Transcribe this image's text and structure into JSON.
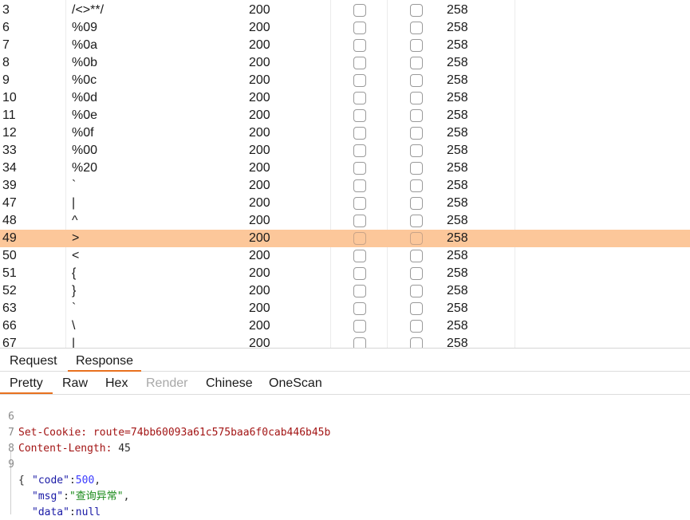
{
  "table": {
    "rows": [
      {
        "num": "3",
        "payload": "/<>**/",
        "status": "200",
        "length": "258",
        "selected": false
      },
      {
        "num": "6",
        "payload": "%09",
        "status": "200",
        "length": "258",
        "selected": false
      },
      {
        "num": "7",
        "payload": "%0a",
        "status": "200",
        "length": "258",
        "selected": false
      },
      {
        "num": "8",
        "payload": "%0b",
        "status": "200",
        "length": "258",
        "selected": false
      },
      {
        "num": "9",
        "payload": "%0c",
        "status": "200",
        "length": "258",
        "selected": false
      },
      {
        "num": "10",
        "payload": "%0d",
        "status": "200",
        "length": "258",
        "selected": false
      },
      {
        "num": "11",
        "payload": "%0e",
        "status": "200",
        "length": "258",
        "selected": false
      },
      {
        "num": "12",
        "payload": "%0f",
        "status": "200",
        "length": "258",
        "selected": false
      },
      {
        "num": "33",
        "payload": "%00",
        "status": "200",
        "length": "258",
        "selected": false
      },
      {
        "num": "34",
        "payload": "%20",
        "status": "200",
        "length": "258",
        "selected": false
      },
      {
        "num": "39",
        "payload": "`",
        "status": "200",
        "length": "258",
        "selected": false
      },
      {
        "num": "47",
        "payload": "|",
        "status": "200",
        "length": "258",
        "selected": false
      },
      {
        "num": "48",
        "payload": "^",
        "status": "200",
        "length": "258",
        "selected": false
      },
      {
        "num": "49",
        "payload": ">",
        "status": "200",
        "length": "258",
        "selected": true
      },
      {
        "num": "50",
        "payload": "<",
        "status": "200",
        "length": "258",
        "selected": false
      },
      {
        "num": "51",
        "payload": "{",
        "status": "200",
        "length": "258",
        "selected": false
      },
      {
        "num": "52",
        "payload": "}",
        "status": "200",
        "length": "258",
        "selected": false
      },
      {
        "num": "63",
        "payload": "`",
        "status": "200",
        "length": "258",
        "selected": false
      },
      {
        "num": "66",
        "payload": "\\",
        "status": "200",
        "length": "258",
        "selected": false
      },
      {
        "num": "67",
        "payload": "|",
        "status": "200",
        "length": "258",
        "selected": false
      }
    ],
    "selected_color": "#fcc79a"
  },
  "message_tabs": {
    "request": "Request",
    "response": "Response",
    "active": "response"
  },
  "view_tabs": {
    "pretty": "Pretty",
    "raw": "Raw",
    "hex": "Hex",
    "render": "Render",
    "chinese": "Chinese",
    "onescan": "OneScan",
    "active": "pretty"
  },
  "editor": {
    "header_line6": {
      "num": "6",
      "name": "Set-Cookie:",
      "value": " route=74bb60093a61c575baa6f0cab446b45b"
    },
    "header_line7": {
      "num": "7",
      "name": "Content-Length:",
      "value": " 45"
    },
    "line8_num": "8",
    "line9_num": "9",
    "open_brace": "{",
    "close_brace": "}",
    "body": {
      "code_key": "\"code\"",
      "code_colon": ":",
      "code_value": "500",
      "code_comma": ",",
      "msg_key": "\"msg\"",
      "msg_colon": ":",
      "msg_value": "\"查询异常\"",
      "msg_comma": ",",
      "data_key": "\"data\"",
      "data_colon": ":",
      "data_value": "null"
    }
  },
  "accent_color": "#e8711f"
}
